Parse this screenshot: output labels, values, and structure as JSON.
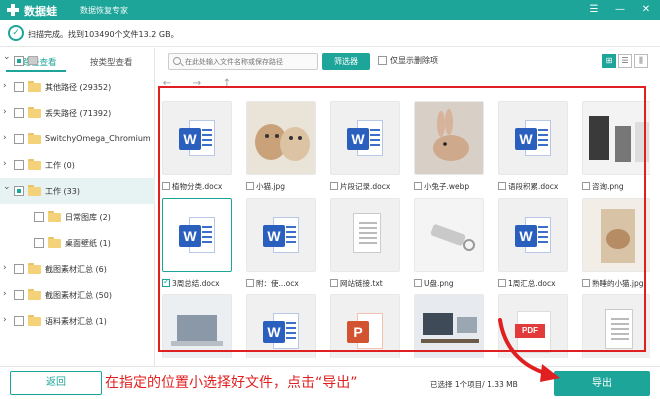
{
  "app": {
    "name": "数据蛙",
    "subtitle": "数据恢复专家"
  },
  "window": {
    "menu_icon": "hamburger-icon",
    "min_label": "—",
    "close_label": "✕"
  },
  "status": {
    "text": "扫描完成。找到103490个文件13.2 GB。",
    "icon": "check-circle-icon"
  },
  "sidebar": {
    "tabs": [
      {
        "label": "按路径查看",
        "active": true
      },
      {
        "label": "按类型查看",
        "active": false
      }
    ],
    "items": [
      {
        "label": "",
        "expanded": true,
        "checked": "partial",
        "type": "drive"
      },
      {
        "label": "其他路径 (29352)",
        "expanded": false,
        "checked": false
      },
      {
        "label": "丢失路径 (71392)",
        "expanded": false,
        "checked": false
      },
      {
        "label": "SwitchyOmega_Chromium",
        "expanded": false,
        "checked": false
      },
      {
        "label": "工作 (0)",
        "expanded": false,
        "checked": false
      },
      {
        "label": "工作 (33)",
        "expanded": true,
        "checked": "partial",
        "selected": true
      },
      {
        "label": "日常图库 (2)",
        "expanded": false,
        "checked": false
      },
      {
        "label": "桌面壁纸 (1)",
        "expanded": false,
        "checked": false
      },
      {
        "label": "截图素材汇总 (6)",
        "expanded": false,
        "checked": false
      },
      {
        "label": "截图素材汇总 (50)",
        "expanded": false,
        "checked": false
      },
      {
        "label": "语料素材汇总 (1)",
        "expanded": false,
        "checked": false
      }
    ]
  },
  "toolbar": {
    "search_placeholder": "在此处输入文件名称或保存路径",
    "filter_label": "筛选器",
    "only_deleted_label": "仅显示删除项",
    "view_modes": [
      "⊞",
      "☰",
      "⫼"
    ]
  },
  "nav": {
    "back": "←",
    "forward": "→",
    "up": "↑"
  },
  "files": [
    {
      "name": "植物分类.docx",
      "kind": "word",
      "checked": false
    },
    {
      "name": "小猫.jpg",
      "kind": "photo-cat",
      "checked": false
    },
    {
      "name": "片段记录.docx",
      "kind": "word",
      "checked": false
    },
    {
      "name": "小兔子.webp",
      "kind": "photo-rabbit",
      "checked": false
    },
    {
      "name": "语段积累.docx",
      "kind": "word",
      "checked": false
    },
    {
      "name": "咨询.png",
      "kind": "photo-office",
      "checked": false
    },
    {
      "name": "3周总结.docx",
      "kind": "word",
      "checked": true,
      "selected": true
    },
    {
      "name": "附：使...ocx",
      "kind": "word",
      "checked": false
    },
    {
      "name": "网站链接.txt",
      "kind": "txt",
      "checked": false
    },
    {
      "name": "U盘.png",
      "kind": "photo-usb",
      "checked": false
    },
    {
      "name": "1周汇总.docx",
      "kind": "word",
      "checked": false
    },
    {
      "name": "熟睡的小猫.jpg",
      "kind": "photo-sleepcat",
      "checked": false
    },
    {
      "name": "",
      "kind": "photo-laptop",
      "checked": false
    },
    {
      "name": "",
      "kind": "word",
      "checked": false
    },
    {
      "name": "",
      "kind": "ppt",
      "checked": false
    },
    {
      "name": "",
      "kind": "photo-desk",
      "checked": false
    },
    {
      "name": "",
      "kind": "pdf",
      "checked": false
    },
    {
      "name": "",
      "kind": "txt",
      "checked": false
    }
  ],
  "bottom": {
    "back_label": "返回",
    "annotation": "在指定的位置小选择好文件，点击“导出”",
    "selection_info": "已选择 1个项目/ 1.33 MB",
    "export_label": "导出"
  },
  "colors": {
    "accent": "#1ea59a",
    "annotation_red": "#e02020",
    "word_blue": "#2b5fbd"
  }
}
